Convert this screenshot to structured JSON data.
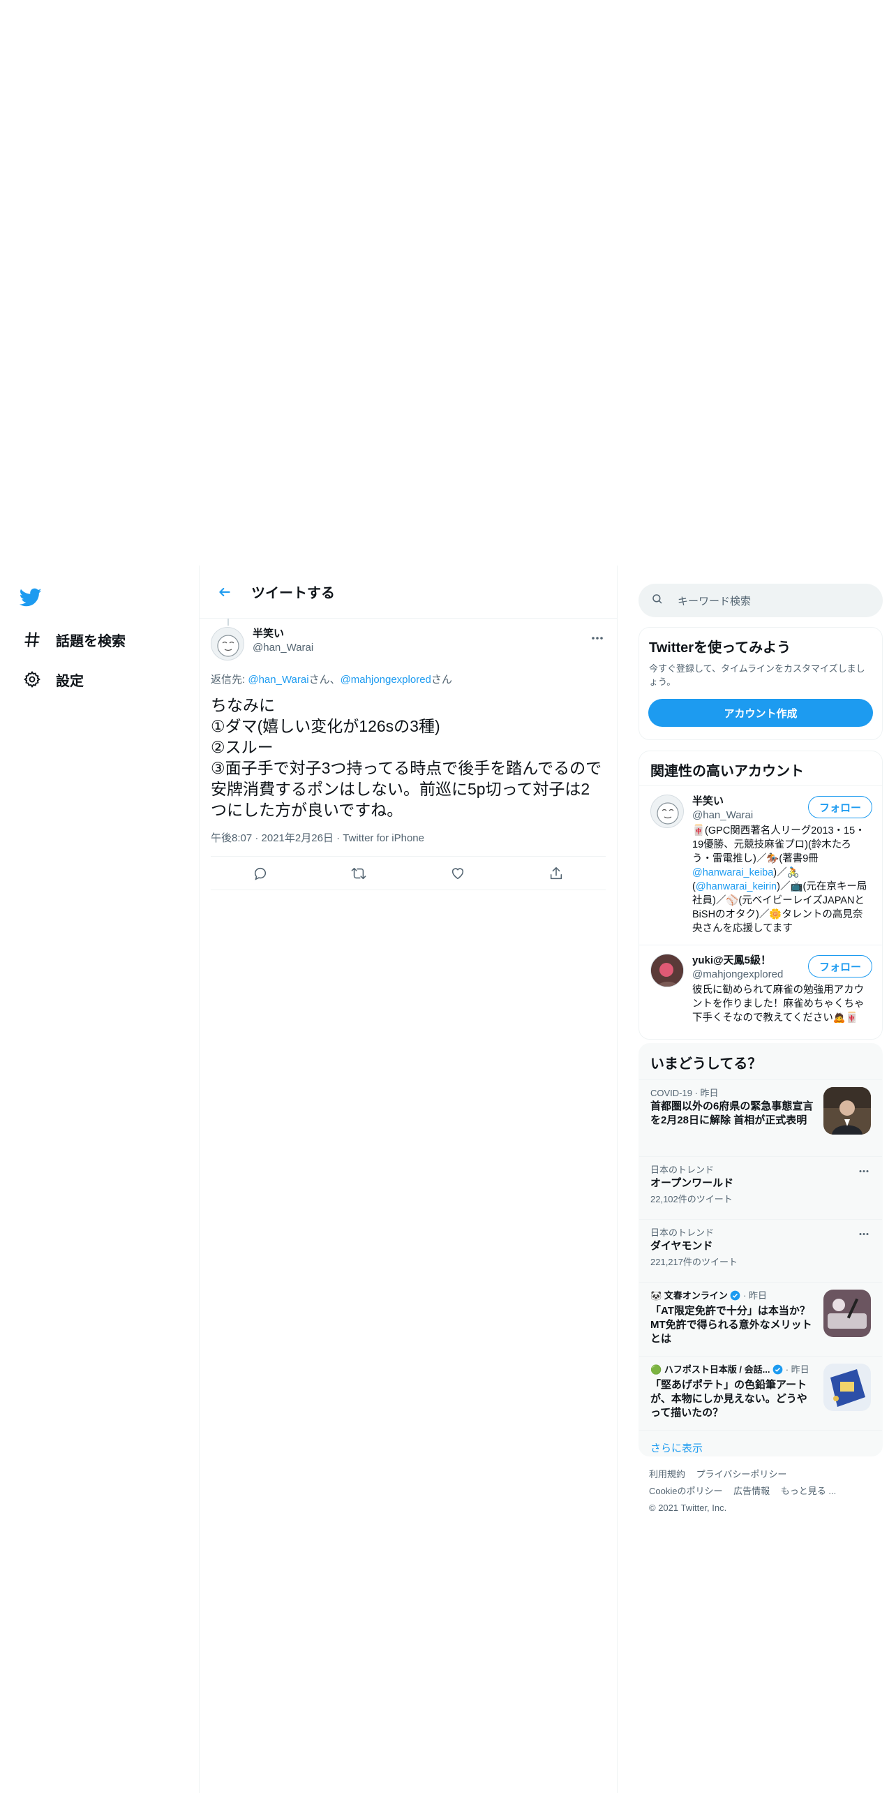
{
  "nav": {
    "explore_label": "話題を検索",
    "settings_label": "設定"
  },
  "header": {
    "title": "ツイートする"
  },
  "tweet": {
    "name": "半笑い",
    "handle": "@han_Warai",
    "reply_prefix": "返信先: ",
    "reply_user1": "@han_Warai",
    "reply_san1": "さん、",
    "reply_user2": "@mahjongexplored",
    "reply_san2": "さん",
    "text": "ちなみに\n①ダマ(嬉しい変化が126sの3種)\n②スルー\n③面子手で対子3つ持ってる時点で後手を踏んでるので安牌消費するポンはしない。前巡に5p切って対子は2つにした方が良いですね。",
    "timestamp": "午後8:07 · 2021年2月26日 · Twitter for iPhone"
  },
  "search": {
    "placeholder": "キーワード検索"
  },
  "signup": {
    "title": "Twitterを使ってみよう",
    "description": "今すぐ登録して、タイムラインをカスタマイズしましょう。",
    "button": "アカウント作成"
  },
  "who_to_follow": {
    "title": "関連性の高いアカウント",
    "follow_label": "フォロー",
    "users": [
      {
        "name": "半笑い",
        "handle": "@han_Warai",
        "bio_1": "🀄(GPC関西著名人リーグ2013・15・19優勝、元競技麻雀プロ)(鈴木たろう・雷電推し)／🏇(著書9冊",
        "bio_link1": "@hanwarai_keiba",
        "bio_2": ")／🚴(",
        "bio_link2": "@hanwarai_keirin",
        "bio_3": ")／📺(元在京キー局社員)／⚾(元ベイビーレイズJAPANとBiSHのオタク)／🌼タレントの高見奈央さんを応援してます"
      },
      {
        "name": "yuki@天鳳5級！",
        "handle": "@mahjongexplored",
        "bio_1": "彼氏に勧められて麻雀の勉強用アカウントを作りました！麻雀めちゃくちゃ下手くそなので教えてください🙇🀄"
      }
    ]
  },
  "trends": {
    "title": "いまどうしてる？",
    "items": [
      {
        "context": "COVID-19 · 昨日",
        "title": "首都圏以外の6府県の緊急事態宣言を2月28日に解除 首相が正式表明"
      },
      {
        "context": "日本のトレンド",
        "title": "オープンワールド",
        "count": "22,102件のツイート"
      },
      {
        "context": "日本のトレンド",
        "title": "ダイヤモンド",
        "count": "221,217件のツイート"
      },
      {
        "source": "文春オンライン",
        "time": " · 昨日",
        "title": "「AT限定免許で十分」は本当か？　MT免許で得られる意外なメリットとは"
      },
      {
        "source": "ハフポスト日本版 / 会話...",
        "time": " · 昨日",
        "title": "「堅あげポテト」の色鉛筆アートが、本物にしか見えない。どうやって描いたの？"
      }
    ],
    "show_more": "さらに表示"
  },
  "footer": {
    "terms": "利用規約",
    "privacy": "プライバシーポリシー",
    "cookie": "Cookieのポリシー",
    "ads": "広告情報",
    "more": "もっと見る ...",
    "copyright": "© 2021 Twitter, Inc."
  },
  "colors": {
    "accent": "#1d9bf0",
    "text": "#0f1419",
    "muted": "#536471"
  }
}
